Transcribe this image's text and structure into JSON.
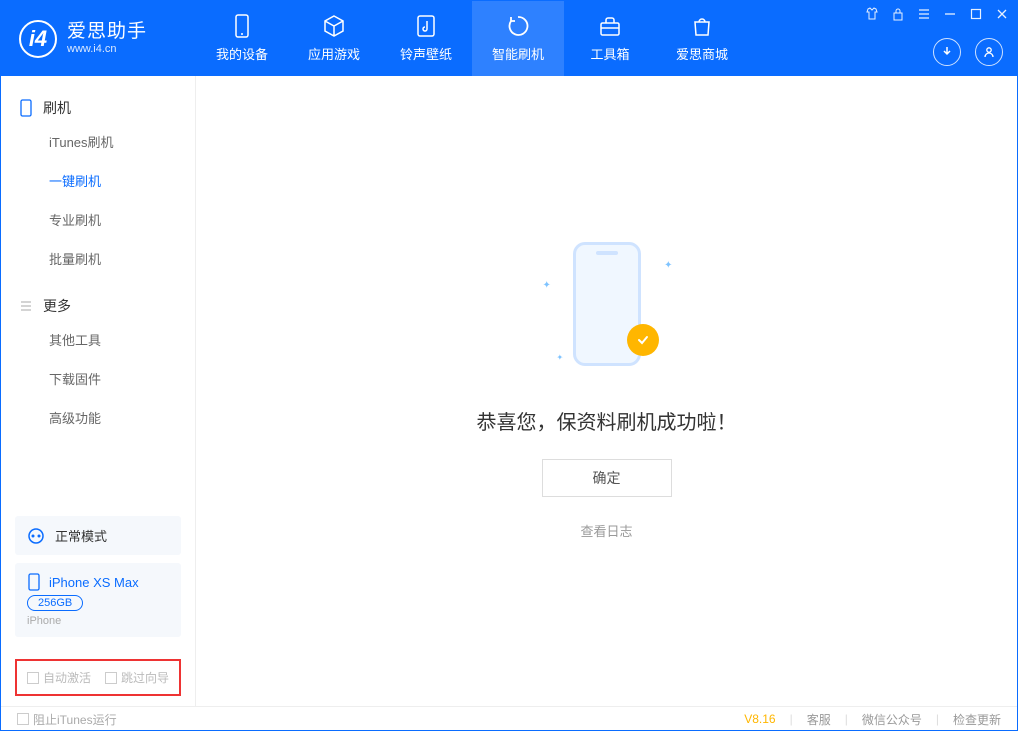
{
  "app": {
    "title": "爱思助手",
    "subtitle": "www.i4.cn"
  },
  "nav": {
    "items": [
      {
        "label": "我的设备"
      },
      {
        "label": "应用游戏"
      },
      {
        "label": "铃声壁纸"
      },
      {
        "label": "智能刷机"
      },
      {
        "label": "工具箱"
      },
      {
        "label": "爱思商城"
      }
    ]
  },
  "sidebar": {
    "section1": {
      "title": "刷机"
    },
    "items1": [
      {
        "label": "iTunes刷机"
      },
      {
        "label": "一键刷机"
      },
      {
        "label": "专业刷机"
      },
      {
        "label": "批量刷机"
      }
    ],
    "section2": {
      "title": "更多"
    },
    "items2": [
      {
        "label": "其他工具"
      },
      {
        "label": "下载固件"
      },
      {
        "label": "高级功能"
      }
    ],
    "mode": "正常模式",
    "device": {
      "name": "iPhone XS Max",
      "capacity": "256GB",
      "type": "iPhone"
    },
    "checkboxes": {
      "auto_activate": "自动激活",
      "skip_guide": "跳过向导"
    }
  },
  "main": {
    "success": "恭喜您，保资料刷机成功啦！",
    "ok": "确定",
    "view_log": "查看日志"
  },
  "footer": {
    "block_itunes": "阻止iTunes运行",
    "version": "V8.16",
    "links": {
      "service": "客服",
      "wechat": "微信公众号",
      "update": "检查更新"
    }
  }
}
